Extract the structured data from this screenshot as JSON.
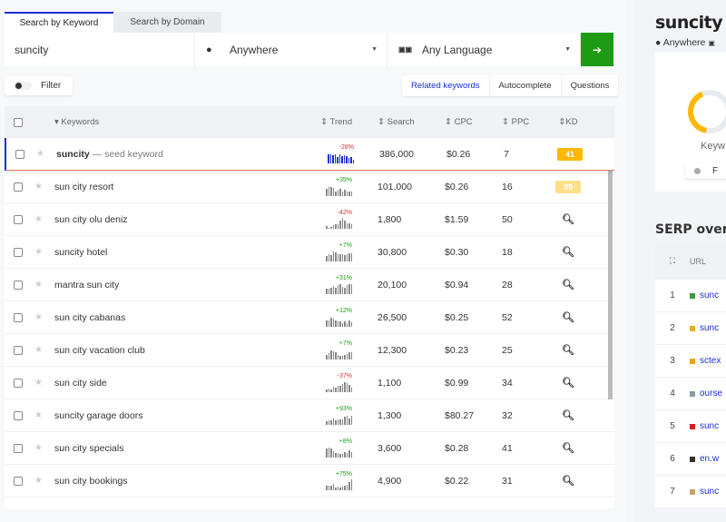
{
  "tabs": [
    "Search by Keyword",
    "Search by Domain"
  ],
  "search": {
    "keyword": "suncity",
    "location": "Anywhere",
    "language": "Any Language",
    "go_icon": "arrow-right"
  },
  "filter_label": "Filter",
  "modes": [
    "Related keywords",
    "Autocomplete",
    "Questions"
  ],
  "columns": [
    "Keywords",
    "Trend",
    "Search",
    "CPC",
    "PPC",
    "KD"
  ],
  "colors": {
    "accent": "#1a2fd6",
    "go": "#1e9b14",
    "kd_high": "#ffb800",
    "kd_mid": "#ffe08a"
  },
  "rows": [
    {
      "kw": "suncity",
      "seed": " — seed keyword",
      "trend": "-28%",
      "search": "386,000",
      "cpc": "$0.26",
      "ppc": "7",
      "kd": "41",
      "spark": [
        10,
        10,
        9,
        10,
        7,
        10,
        8,
        9,
        8,
        6,
        7,
        4
      ]
    },
    {
      "kw": "sun city resort",
      "trend": "+35%",
      "search": "101,000",
      "cpc": "$0.26",
      "ppc": "16",
      "kd": "39",
      "spark": [
        8,
        10,
        10,
        9,
        5,
        7,
        8,
        5,
        7,
        5,
        5,
        5
      ]
    },
    {
      "kw": "sun city olu deniz",
      "trend": "-42%",
      "search": "1,800",
      "cpc": "$1.59",
      "ppc": "50",
      "kd": null,
      "spark": [
        3,
        1,
        2,
        4,
        5,
        5,
        9,
        12,
        9,
        6,
        6,
        5
      ]
    },
    {
      "kw": "suncity hotel",
      "trend": "+7%",
      "search": "30,800",
      "cpc": "$0.30",
      "ppc": "18",
      "kd": null,
      "spark": [
        6,
        8,
        7,
        11,
        10,
        8,
        8,
        8,
        7,
        8,
        9,
        9
      ]
    },
    {
      "kw": "mantra sun city",
      "trend": "+31%",
      "search": "20,100",
      "cpc": "$0.94",
      "ppc": "28",
      "kd": null,
      "spark": [
        6,
        6,
        7,
        9,
        7,
        10,
        11,
        8,
        7,
        10,
        11,
        11
      ]
    },
    {
      "kw": "sun city cabanas",
      "trend": "+12%",
      "search": "26,500",
      "cpc": "$0.25",
      "ppc": "52",
      "kd": null,
      "spark": [
        7,
        7,
        10,
        9,
        7,
        6,
        6,
        4,
        6,
        4,
        7,
        5
      ]
    },
    {
      "kw": "sun city vacation club",
      "trend": "+7%",
      "search": "12,300",
      "cpc": "$0.23",
      "ppc": "25",
      "kd": null,
      "spark": [
        5,
        7,
        10,
        9,
        8,
        5,
        4,
        4,
        5,
        6,
        8,
        8
      ]
    },
    {
      "kw": "sun city side",
      "trend": "-37%",
      "search": "1,100",
      "cpc": "$0.99",
      "ppc": "34",
      "kd": null,
      "spark": [
        3,
        4,
        3,
        6,
        5,
        7,
        7,
        9,
        11,
        10,
        8,
        5
      ]
    },
    {
      "kw": "suncity garage doors",
      "trend": "+93%",
      "search": "1,300",
      "cpc": "$80.27",
      "ppc": "32",
      "kd": null,
      "spark": [
        4,
        5,
        5,
        7,
        5,
        6,
        6,
        6,
        9,
        10,
        7,
        10
      ]
    },
    {
      "kw": "sun city specials",
      "trend": "+8%",
      "search": "3,600",
      "cpc": "$0.28",
      "ppc": "41",
      "kd": null,
      "spark": [
        10,
        11,
        10,
        7,
        5,
        5,
        4,
        4,
        6,
        5,
        8,
        6
      ]
    },
    {
      "kw": "sun city bookings",
      "trend": "+75%",
      "search": "4,900",
      "cpc": "$0.22",
      "ppc": "31",
      "kd": null,
      "spark": [
        5,
        5,
        5,
        7,
        3,
        4,
        3,
        4,
        5,
        6,
        9,
        12
      ]
    }
  ],
  "right": {
    "title": "suncity",
    "location": "Anywhere",
    "card_label": "Keyw",
    "card_toggle": "F",
    "serp_title": "SERP overvi",
    "serp_url_header": "URL",
    "serp": [
      {
        "n": "1",
        "u": "sunc",
        "c": "#3a9b3a"
      },
      {
        "n": "2",
        "u": "sunc",
        "c": "#e5b020"
      },
      {
        "n": "3",
        "u": "sctex",
        "c": "#f0a020"
      },
      {
        "n": "4",
        "u": "ourse",
        "c": "#8899aa"
      },
      {
        "n": "5",
        "u": "sunc",
        "c": "#d42020"
      },
      {
        "n": "6",
        "u": "en.w",
        "c": "#333"
      },
      {
        "n": "7",
        "u": "sunc",
        "c": "#c8a070"
      }
    ]
  }
}
